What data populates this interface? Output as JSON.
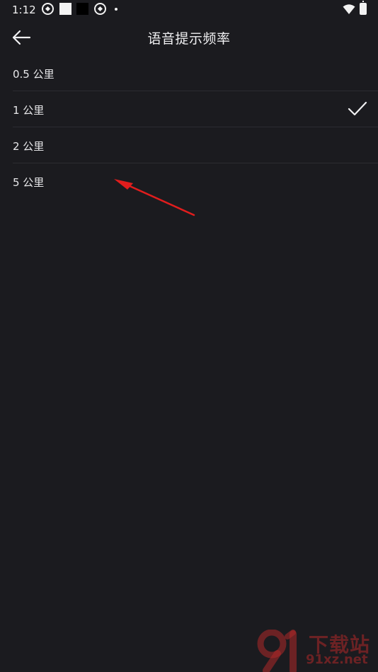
{
  "status_bar": {
    "time": "1:12",
    "icons": [
      "aperture-icon",
      "white-square-icon",
      "black-square-icon",
      "aperture-icon",
      "dot-icon",
      "wifi-icon",
      "battery-icon"
    ]
  },
  "toolbar": {
    "title": "语音提示频率",
    "back_icon": "arrow-left-icon"
  },
  "options": [
    {
      "label": "0.5 公里",
      "selected": false
    },
    {
      "label": "1 公里",
      "selected": true
    },
    {
      "label": "2 公里",
      "selected": false
    },
    {
      "label": "5 公里",
      "selected": false
    }
  ],
  "annotation": {
    "color": "#e11d1d"
  },
  "watermark": {
    "title": "下载站",
    "domain": "91xz.net",
    "color": "#b02a2a"
  }
}
